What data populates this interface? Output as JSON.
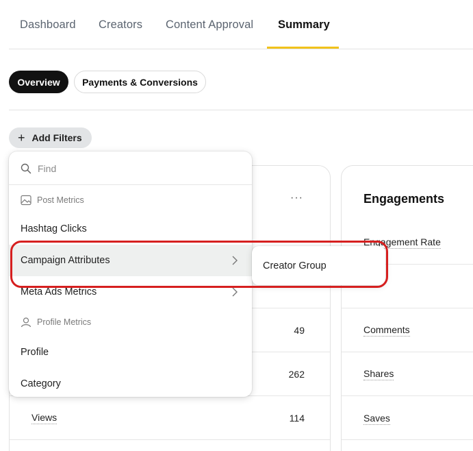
{
  "nav": {
    "tabs": [
      {
        "label": "Dashboard"
      },
      {
        "label": "Creators"
      },
      {
        "label": "Content Approval"
      },
      {
        "label": "Summary"
      }
    ],
    "active_tab": "Summary"
  },
  "view_toggle": {
    "overview_label": "Overview",
    "payments_label": "Payments & Conversions",
    "active": "Overview"
  },
  "filters": {
    "add_label": "Add Filters",
    "search_placeholder": "Find",
    "post_metrics_header": "Post Metrics",
    "hashtag_clicks": "Hashtag Clicks",
    "campaign_attributes": "Campaign Attributes",
    "meta_ads_metrics": "Meta Ads Metrics",
    "profile_metrics_header": "Profile Metrics",
    "profile": "Profile",
    "category": "Category",
    "submenu_creator_group": "Creator Group"
  },
  "left_card": {
    "more_label": "···",
    "rows": [
      {
        "value": "49"
      },
      {
        "value": "262"
      },
      {
        "label": "Views",
        "value": "114"
      }
    ]
  },
  "engagements_card": {
    "title": "Engagements",
    "rows": [
      {
        "label": "Engagement Rate"
      },
      {
        "label": "Comments"
      },
      {
        "label": "Shares"
      },
      {
        "label": "Saves"
      }
    ]
  },
  "colors": {
    "accent_underline": "#f1c21b",
    "active_pill_bg": "#111111",
    "highlight_border": "#d61f1f",
    "hover_bg": "#eef0ef"
  }
}
